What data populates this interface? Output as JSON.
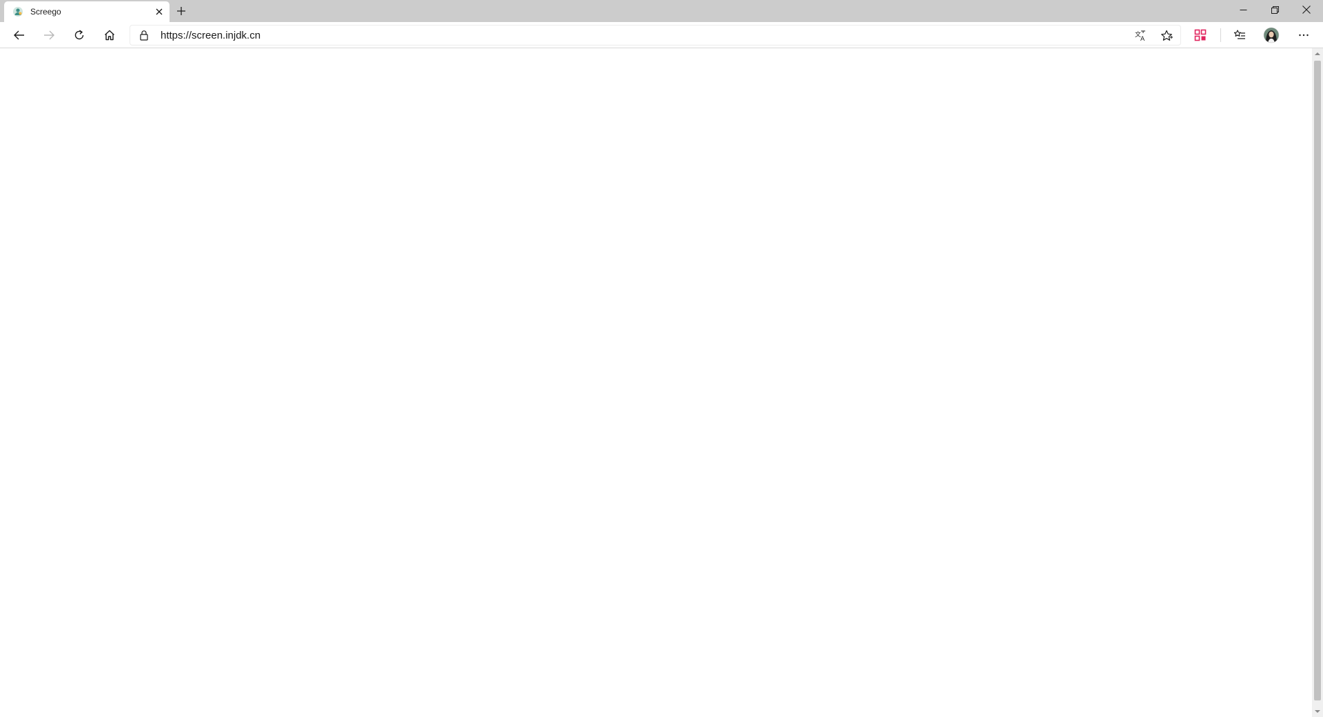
{
  "tab": {
    "title": "Screego",
    "favicon": "screego-favicon-icon",
    "close_icon": "close-icon"
  },
  "tabstrip": {
    "new_tab_icon": "plus-icon"
  },
  "window_controls": {
    "minimize_icon": "minimize-icon",
    "restore_icon": "restore-icon",
    "close_icon": "close-icon"
  },
  "toolbar": {
    "back_icon": "back-arrow-icon",
    "forward_icon": "forward-arrow-icon",
    "refresh_icon": "refresh-icon",
    "home_icon": "home-icon",
    "collections_icon": "collections-icon",
    "favorites_icon": "favorites-list-icon",
    "profile_icon": "avatar",
    "menu_icon": "more-dots-icon"
  },
  "address_bar": {
    "url": "https://screen.injdk.cn",
    "lock_icon": "lock-icon",
    "translate_icon": "translate-icon",
    "star_icon": "star-icon"
  },
  "colors": {
    "tabstrip_bg": "#cccccc",
    "accent_collections": "#e0245e"
  }
}
